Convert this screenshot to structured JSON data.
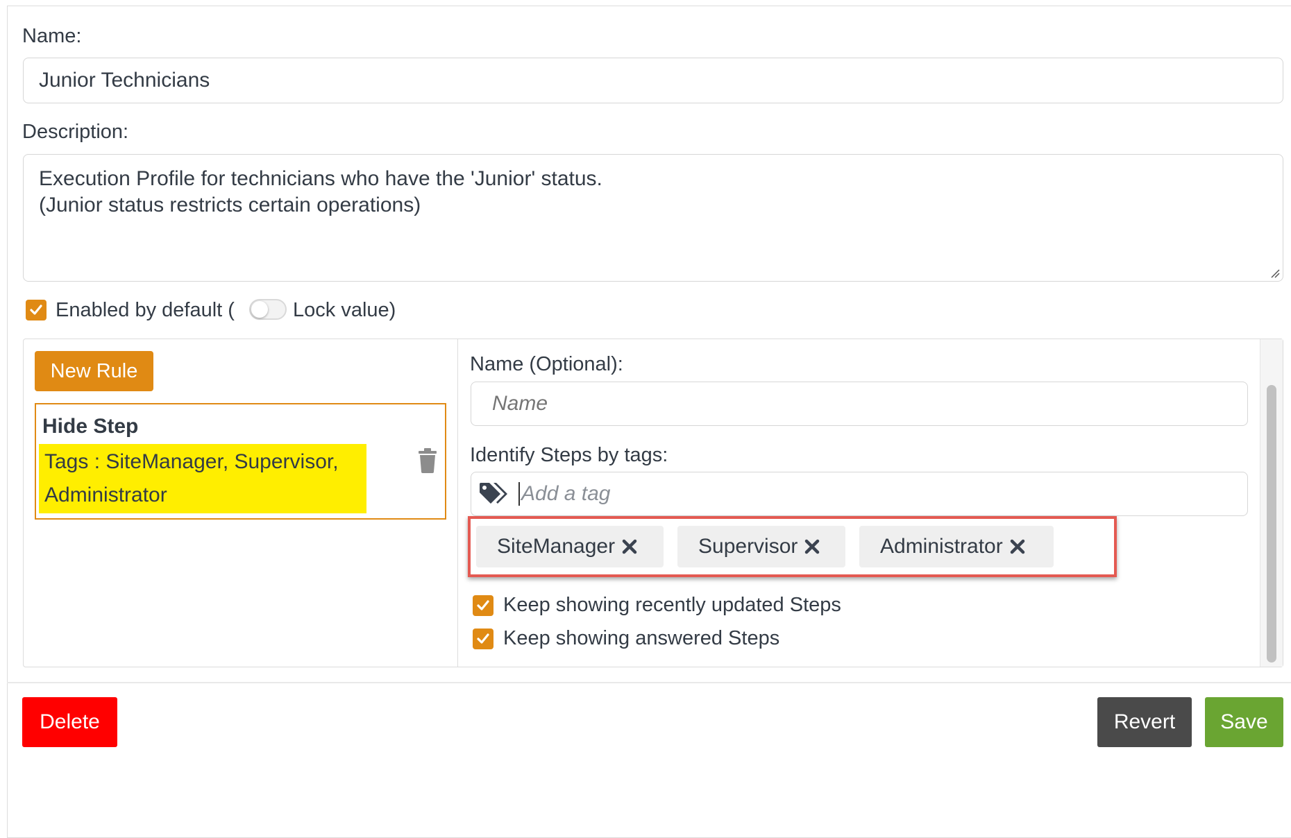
{
  "form": {
    "name_label": "Name:",
    "name_value": "Junior Technicians",
    "description_label": "Description:",
    "description_value": "Execution Profile for technicians who have the 'Junior' status.\n(Junior status restricts certain operations)",
    "enabled_label": "Enabled by default (",
    "lock_label": "Lock value)"
  },
  "rules": {
    "new_rule_label": "New Rule",
    "items": [
      {
        "title": "Hide Step",
        "tags_text": "Tags : SiteManager, Supervisor, Administrator"
      }
    ]
  },
  "rule_editor": {
    "name_label": "Name (Optional):",
    "name_placeholder": "Name",
    "tags_label": "Identify Steps by tags:",
    "tag_placeholder": "Add a tag",
    "tags": [
      "SiteManager",
      "Supervisor",
      "Administrator"
    ],
    "keep_updated_label": "Keep showing recently updated Steps",
    "keep_answered_label": "Keep showing answered Steps"
  },
  "footer": {
    "delete_label": "Delete",
    "revert_label": "Revert",
    "save_label": "Save"
  },
  "colors": {
    "accent": "#e08a14",
    "delete": "#ff0000",
    "revert": "#4a4a4a",
    "save": "#6aa532",
    "tag_highlight": "#ffee00",
    "annotation": "#e45a52"
  },
  "icons": [
    "check-icon",
    "tag-icon",
    "trash-icon",
    "close-icon",
    "resize-grip-icon"
  ]
}
